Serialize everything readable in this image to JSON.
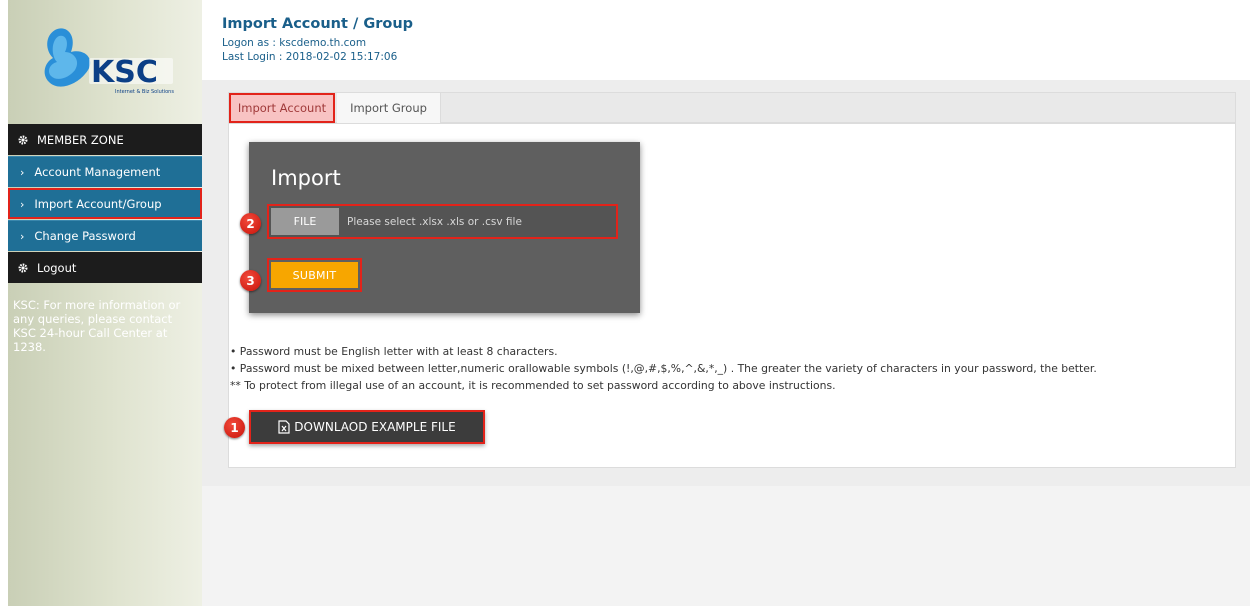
{
  "header": {
    "title": "Import Account / Group",
    "logon": "Logon as : kscdemo.th.com",
    "last_login": "Last Login : 2018-02-02 15:17:06"
  },
  "logo": {
    "text": "KSC",
    "tagline": "Internet & Biz Solutions"
  },
  "sidebar": {
    "section_title": "MEMBER ZONE",
    "items": [
      {
        "label": "Account Management"
      },
      {
        "label": "Import Account/Group"
      },
      {
        "label": "Change Password"
      }
    ],
    "logout_label": "Logout",
    "note": "KSC: For more information or any queries, please contact KSC 24-hour Call Center at 1238."
  },
  "tabs": [
    {
      "label": "Import Account"
    },
    {
      "label": "Import Group"
    }
  ],
  "import": {
    "title": "Import",
    "file_label": "FILE",
    "file_placeholder": "Please select .xlsx .xls or .csv file",
    "submit_label": "SUBMIT"
  },
  "rules": [
    "• Password must be English letter with at least 8 characters.",
    "• Password must be mixed between letter,numeric orallowable symbols (!,@,#,$,%,^,&,*,_) . The greater the variety of characters in your password, the better.",
    "** To protect from illegal use of an account, it is recommended to set password according to above instructions."
  ],
  "download_label": "DOWNLAOD EXAMPLE FILE",
  "badges": [
    "1",
    "2",
    "3"
  ],
  "colors": {
    "accent_blue": "#1f6f96",
    "highlight_red": "#e2231a",
    "submit_orange": "#f7a600"
  }
}
